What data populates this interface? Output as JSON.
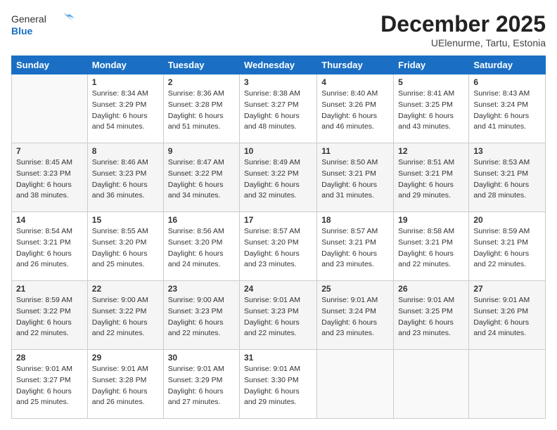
{
  "logo": {
    "general": "General",
    "blue": "Blue"
  },
  "title": "December 2025",
  "location": "UElenurme, Tartu, Estonia",
  "weekdays": [
    "Sunday",
    "Monday",
    "Tuesday",
    "Wednesday",
    "Thursday",
    "Friday",
    "Saturday"
  ],
  "weeks": [
    [
      {
        "day": "",
        "sunrise": "",
        "sunset": "",
        "daylight": ""
      },
      {
        "day": "1",
        "sunrise": "Sunrise: 8:34 AM",
        "sunset": "Sunset: 3:29 PM",
        "daylight": "Daylight: 6 hours and 54 minutes."
      },
      {
        "day": "2",
        "sunrise": "Sunrise: 8:36 AM",
        "sunset": "Sunset: 3:28 PM",
        "daylight": "Daylight: 6 hours and 51 minutes."
      },
      {
        "day": "3",
        "sunrise": "Sunrise: 8:38 AM",
        "sunset": "Sunset: 3:27 PM",
        "daylight": "Daylight: 6 hours and 48 minutes."
      },
      {
        "day": "4",
        "sunrise": "Sunrise: 8:40 AM",
        "sunset": "Sunset: 3:26 PM",
        "daylight": "Daylight: 6 hours and 46 minutes."
      },
      {
        "day": "5",
        "sunrise": "Sunrise: 8:41 AM",
        "sunset": "Sunset: 3:25 PM",
        "daylight": "Daylight: 6 hours and 43 minutes."
      },
      {
        "day": "6",
        "sunrise": "Sunrise: 8:43 AM",
        "sunset": "Sunset: 3:24 PM",
        "daylight": "Daylight: 6 hours and 41 minutes."
      }
    ],
    [
      {
        "day": "7",
        "sunrise": "Sunrise: 8:45 AM",
        "sunset": "Sunset: 3:23 PM",
        "daylight": "Daylight: 6 hours and 38 minutes."
      },
      {
        "day": "8",
        "sunrise": "Sunrise: 8:46 AM",
        "sunset": "Sunset: 3:23 PM",
        "daylight": "Daylight: 6 hours and 36 minutes."
      },
      {
        "day": "9",
        "sunrise": "Sunrise: 8:47 AM",
        "sunset": "Sunset: 3:22 PM",
        "daylight": "Daylight: 6 hours and 34 minutes."
      },
      {
        "day": "10",
        "sunrise": "Sunrise: 8:49 AM",
        "sunset": "Sunset: 3:22 PM",
        "daylight": "Daylight: 6 hours and 32 minutes."
      },
      {
        "day": "11",
        "sunrise": "Sunrise: 8:50 AM",
        "sunset": "Sunset: 3:21 PM",
        "daylight": "Daylight: 6 hours and 31 minutes."
      },
      {
        "day": "12",
        "sunrise": "Sunrise: 8:51 AM",
        "sunset": "Sunset: 3:21 PM",
        "daylight": "Daylight: 6 hours and 29 minutes."
      },
      {
        "day": "13",
        "sunrise": "Sunrise: 8:53 AM",
        "sunset": "Sunset: 3:21 PM",
        "daylight": "Daylight: 6 hours and 28 minutes."
      }
    ],
    [
      {
        "day": "14",
        "sunrise": "Sunrise: 8:54 AM",
        "sunset": "Sunset: 3:21 PM",
        "daylight": "Daylight: 6 hours and 26 minutes."
      },
      {
        "day": "15",
        "sunrise": "Sunrise: 8:55 AM",
        "sunset": "Sunset: 3:20 PM",
        "daylight": "Daylight: 6 hours and 25 minutes."
      },
      {
        "day": "16",
        "sunrise": "Sunrise: 8:56 AM",
        "sunset": "Sunset: 3:20 PM",
        "daylight": "Daylight: 6 hours and 24 minutes."
      },
      {
        "day": "17",
        "sunrise": "Sunrise: 8:57 AM",
        "sunset": "Sunset: 3:20 PM",
        "daylight": "Daylight: 6 hours and 23 minutes."
      },
      {
        "day": "18",
        "sunrise": "Sunrise: 8:57 AM",
        "sunset": "Sunset: 3:21 PM",
        "daylight": "Daylight: 6 hours and 23 minutes."
      },
      {
        "day": "19",
        "sunrise": "Sunrise: 8:58 AM",
        "sunset": "Sunset: 3:21 PM",
        "daylight": "Daylight: 6 hours and 22 minutes."
      },
      {
        "day": "20",
        "sunrise": "Sunrise: 8:59 AM",
        "sunset": "Sunset: 3:21 PM",
        "daylight": "Daylight: 6 hours and 22 minutes."
      }
    ],
    [
      {
        "day": "21",
        "sunrise": "Sunrise: 8:59 AM",
        "sunset": "Sunset: 3:22 PM",
        "daylight": "Daylight: 6 hours and 22 minutes."
      },
      {
        "day": "22",
        "sunrise": "Sunrise: 9:00 AM",
        "sunset": "Sunset: 3:22 PM",
        "daylight": "Daylight: 6 hours and 22 minutes."
      },
      {
        "day": "23",
        "sunrise": "Sunrise: 9:00 AM",
        "sunset": "Sunset: 3:23 PM",
        "daylight": "Daylight: 6 hours and 22 minutes."
      },
      {
        "day": "24",
        "sunrise": "Sunrise: 9:01 AM",
        "sunset": "Sunset: 3:23 PM",
        "daylight": "Daylight: 6 hours and 22 minutes."
      },
      {
        "day": "25",
        "sunrise": "Sunrise: 9:01 AM",
        "sunset": "Sunset: 3:24 PM",
        "daylight": "Daylight: 6 hours and 23 minutes."
      },
      {
        "day": "26",
        "sunrise": "Sunrise: 9:01 AM",
        "sunset": "Sunset: 3:25 PM",
        "daylight": "Daylight: 6 hours and 23 minutes."
      },
      {
        "day": "27",
        "sunrise": "Sunrise: 9:01 AM",
        "sunset": "Sunset: 3:26 PM",
        "daylight": "Daylight: 6 hours and 24 minutes."
      }
    ],
    [
      {
        "day": "28",
        "sunrise": "Sunrise: 9:01 AM",
        "sunset": "Sunset: 3:27 PM",
        "daylight": "Daylight: 6 hours and 25 minutes."
      },
      {
        "day": "29",
        "sunrise": "Sunrise: 9:01 AM",
        "sunset": "Sunset: 3:28 PM",
        "daylight": "Daylight: 6 hours and 26 minutes."
      },
      {
        "day": "30",
        "sunrise": "Sunrise: 9:01 AM",
        "sunset": "Sunset: 3:29 PM",
        "daylight": "Daylight: 6 hours and 27 minutes."
      },
      {
        "day": "31",
        "sunrise": "Sunrise: 9:01 AM",
        "sunset": "Sunset: 3:30 PM",
        "daylight": "Daylight: 6 hours and 29 minutes."
      },
      {
        "day": "",
        "sunrise": "",
        "sunset": "",
        "daylight": ""
      },
      {
        "day": "",
        "sunrise": "",
        "sunset": "",
        "daylight": ""
      },
      {
        "day": "",
        "sunrise": "",
        "sunset": "",
        "daylight": ""
      }
    ]
  ]
}
